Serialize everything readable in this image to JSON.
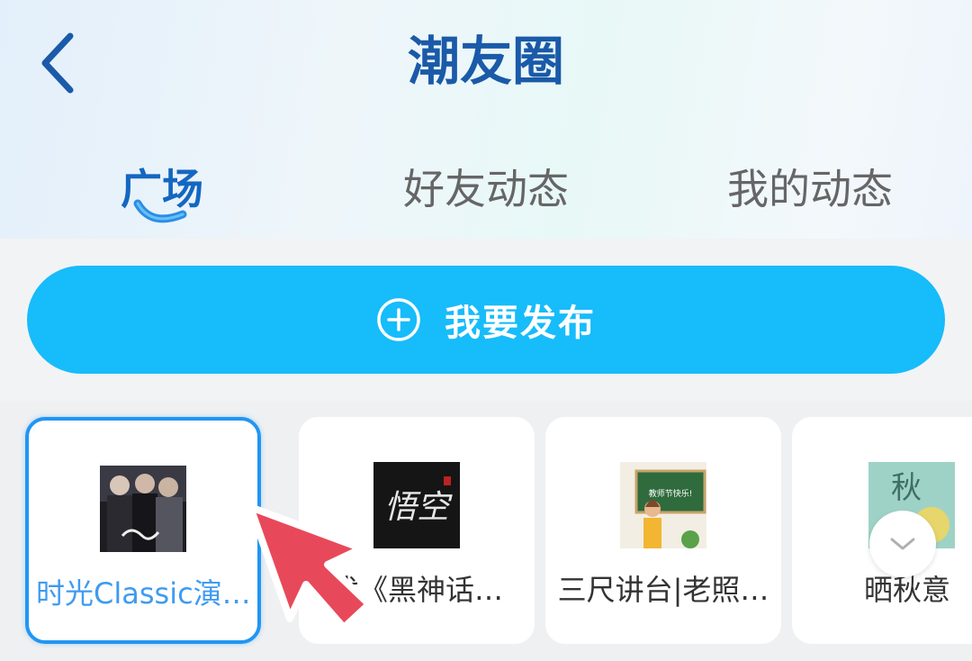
{
  "header": {
    "title": "潮友圈",
    "back_icon": "chevron-left-icon"
  },
  "tabs": [
    {
      "label": "广场",
      "active": true
    },
    {
      "label": "好友动态",
      "active": false
    },
    {
      "label": "我的动态",
      "active": false
    }
  ],
  "publish": {
    "label": "我要发布",
    "icon": "plus-circle-icon"
  },
  "topics": [
    {
      "label": "时光Classic演…",
      "selected": true
    },
    {
      "label": "找《黑神话…",
      "selected": false
    },
    {
      "label": "三尺讲台|老照…",
      "selected": false
    },
    {
      "label": "晒秋意",
      "selected": false
    }
  ],
  "thumbs": {
    "wukong_text": "悟空",
    "teacher_board_text": "教师节快乐!",
    "autumn_text": "秋"
  },
  "expand": {
    "icon": "chevron-down-icon"
  },
  "colors": {
    "accent": "#17bcfa",
    "title": "#1a5aa8",
    "active_tab": "#1467c0",
    "selected_border": "#2196f3",
    "pointer": "#e8495a"
  }
}
